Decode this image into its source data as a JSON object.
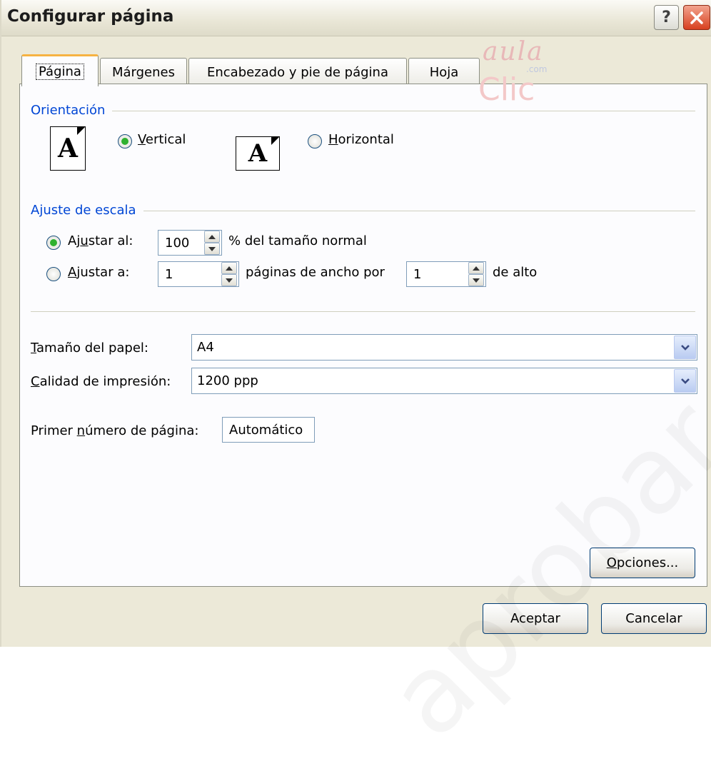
{
  "window": {
    "title": "Configurar página",
    "help": "?"
  },
  "tabs": [
    {
      "label": "Página"
    },
    {
      "label": "Márgenes"
    },
    {
      "label": "Encabezado y pie de página"
    },
    {
      "label": "Hoja"
    }
  ],
  "logo": {
    "top": "aula",
    "sub": ".com",
    "bottom": "Clic"
  },
  "watermark": "aprobar.es",
  "orientation": {
    "title": "Orientación",
    "icon_letter": "A",
    "vertical": {
      "mnemonic": "V",
      "rest": "ertical",
      "checked": true
    },
    "horizontal": {
      "mnemonic": "H",
      "rest": "orizontal",
      "checked": false
    }
  },
  "scale": {
    "title": "Ajuste de escala",
    "adjust_to": {
      "pre": "Aj",
      "mnemonic": "u",
      "post": "star al:",
      "value": "100",
      "suffix": "% del tamaño normal",
      "checked": true
    },
    "fit_to": {
      "pre": "",
      "mnemonic": "A",
      "post": "justar a:",
      "wide_value": "1",
      "wide_suffix": "páginas de ancho por",
      "tall_value": "1",
      "tall_suffix": "de alto",
      "checked": false
    }
  },
  "paper_size": {
    "mnemonic": "T",
    "rest": "amaño del papel:",
    "value": "A4"
  },
  "print_quality": {
    "mnemonic": "C",
    "rest": "alidad de impresión:",
    "value": "1200 ppp"
  },
  "first_page": {
    "pre": "Primer ",
    "mnemonic": "n",
    "post": "úmero de página:",
    "value": "Automático"
  },
  "buttons": {
    "options": {
      "mnemonic": "O",
      "rest": "pciones..."
    },
    "accept": "Aceptar",
    "cancel": "Cancelar"
  }
}
